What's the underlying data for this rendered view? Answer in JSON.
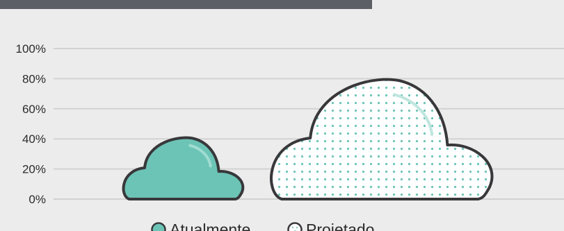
{
  "chart_data": {
    "type": "bar",
    "title": "",
    "xlabel": "",
    "ylabel": "",
    "ylim": [
      0,
      100
    ],
    "grid": true,
    "y_ticks": [
      "0%",
      "20%",
      "40%",
      "60%",
      "80%",
      "100%"
    ],
    "categories": [
      "Atualmente",
      "Projetado"
    ],
    "values": [
      40,
      78
    ],
    "unit": "%",
    "mark": "cloud",
    "legend": {
      "placement": "bottom-center",
      "entries": [
        {
          "label": "Atualmente",
          "style": "solid"
        },
        {
          "label": "Projetado",
          "style": "dotted"
        }
      ]
    },
    "colors": {
      "fill": "#6cc4b6",
      "outline": "#38383b",
      "dots": "#6cc4b6",
      "gridline": "#d2d2d2",
      "background": "#ececec",
      "top_bar": "#5d5f66"
    }
  }
}
